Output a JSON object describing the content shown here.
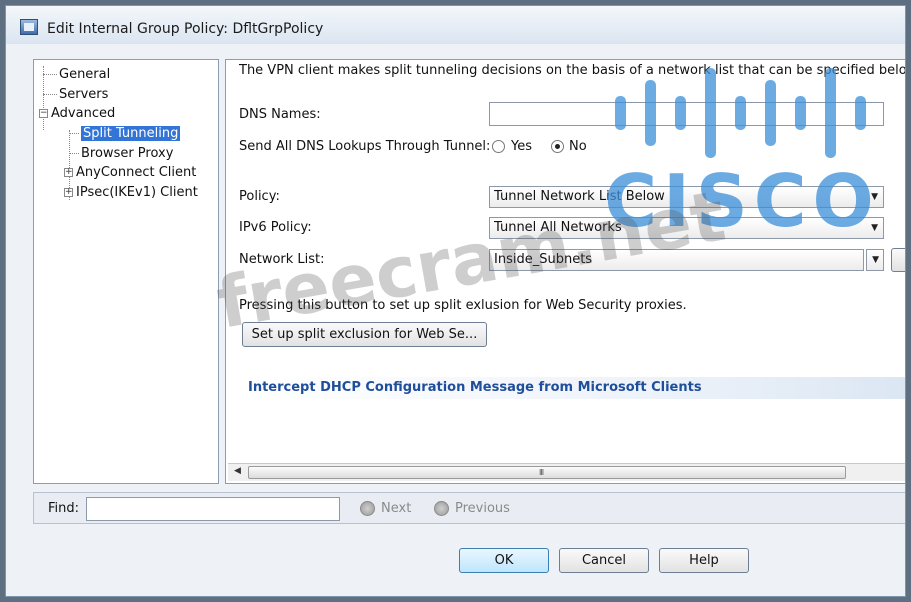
{
  "window": {
    "title": "Edit Internal Group Policy: DfltGrpPolicy"
  },
  "tree": {
    "general": "General",
    "servers": "Servers",
    "advanced": "Advanced",
    "split_tunneling": "Split Tunneling",
    "browser_proxy": "Browser Proxy",
    "anyconnect": "AnyConnect Client",
    "ipsec": "IPsec(IKEv1) Client"
  },
  "main": {
    "description": "The VPN client makes split tunneling decisions on the basis of a network list that can be specified below",
    "dns_names_label": "DNS Names:",
    "dns_names_value": "",
    "send_dns_label": "Send All DNS Lookups Through Tunnel:",
    "radio_yes": "Yes",
    "radio_no": "No",
    "radio_selected": "No",
    "policy_label": "Policy:",
    "policy_value": "Tunnel Network List Below",
    "ipv6_label": "IPv6 Policy:",
    "ipv6_value": "Tunnel All Networks",
    "netlist_label": "Network List:",
    "netlist_value": "Inside_Subnets",
    "proxy_note": "Pressing this button to set up split exlusion for Web Security proxies.",
    "split_exclusion_button": "Set up split exclusion for Web Se...",
    "intercept_heading": "Intercept DHCP Configuration Message from Microsoft Clients",
    "scroll_grip": "III"
  },
  "find": {
    "label": "Find:",
    "value": "",
    "next": "Next",
    "previous": "Previous"
  },
  "buttons": {
    "ok": "OK",
    "cancel": "Cancel",
    "help": "Help"
  },
  "watermarks": {
    "site": "freecram.net",
    "brand": "CISCO"
  },
  "colors": {
    "accent": "#3375d6",
    "section_heading": "#1f4e9a",
    "cisco_blue": "#3b8fd9"
  }
}
